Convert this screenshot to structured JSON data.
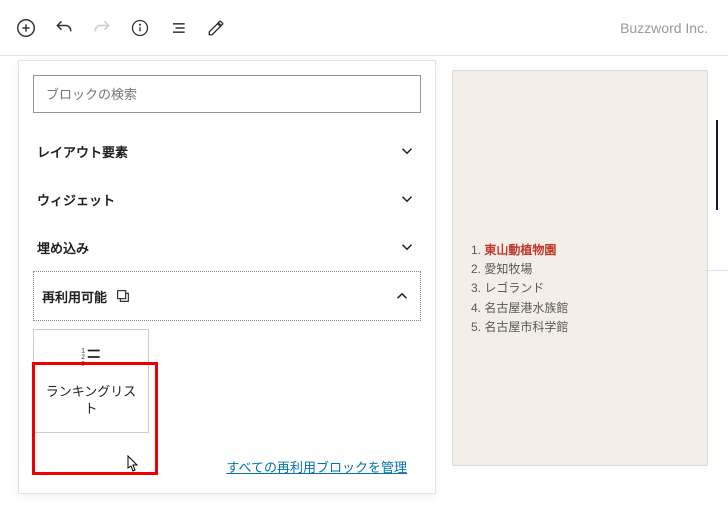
{
  "brand": "Buzzword Inc.",
  "search": {
    "placeholder": "ブロックの検索"
  },
  "categories": [
    {
      "label": "レイアウト要素",
      "expanded": false
    },
    {
      "label": "ウィジェット",
      "expanded": false
    },
    {
      "label": "埋め込み",
      "expanded": false
    },
    {
      "label": "再利用可能",
      "expanded": true
    }
  ],
  "reusable_block": {
    "label": "ランキングリスト"
  },
  "manage_link": "すべての再利用ブロックを管理",
  "preview_list": [
    "東山動植物園",
    "愛知牧場",
    "レゴランド",
    "名古屋港水族館",
    "名古屋市科学館"
  ],
  "chart_data": null
}
